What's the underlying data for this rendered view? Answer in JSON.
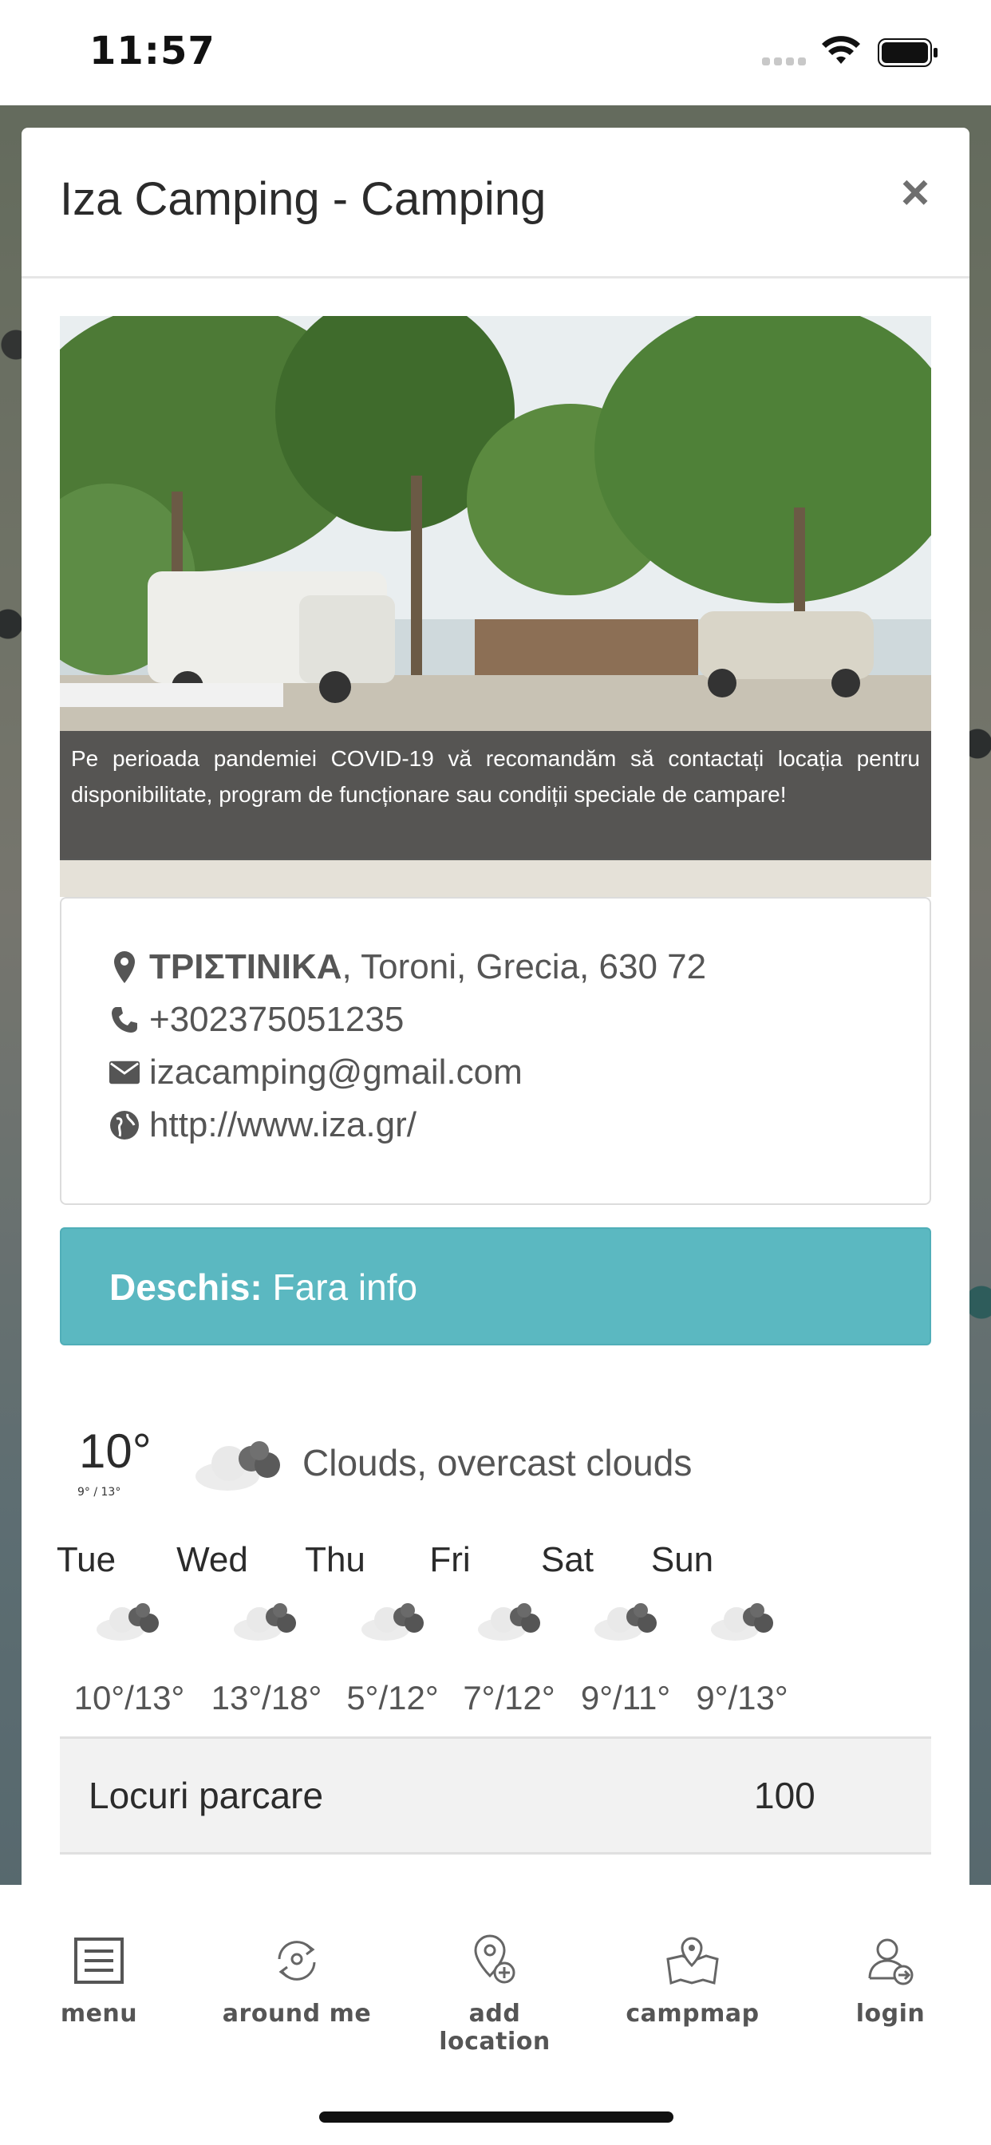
{
  "status_bar": {
    "time": "11:57"
  },
  "modal": {
    "title": "Iza Camping - Camping",
    "close_label": "×",
    "covid_notice": "Pe perioada pandemiei COVID-19 vă recomandăm să contactați locația pentru disponibilitate, program de funcționare sau condiții speciale de campare!"
  },
  "contact": {
    "address_bold": "ΤΡΙΣΤΙΝΙΚΑ",
    "address_rest": ", Toroni, Grecia, 630 72",
    "phone": "+302375051235",
    "email": "izacamping@gmail.com",
    "website": "http://www.iza.gr/"
  },
  "open_status": {
    "label": "Deschis:",
    "value": "Fara info"
  },
  "weather": {
    "current_temp": "10°",
    "current_range": "9° / 13°",
    "description": "Clouds, overcast clouds",
    "forecast": [
      {
        "day": "Tue",
        "temp": "10°/13°"
      },
      {
        "day": "Wed",
        "temp": "13°/18°"
      },
      {
        "day": "Thu",
        "temp": "5°/12°"
      },
      {
        "day": "Fri",
        "temp": "7°/12°"
      },
      {
        "day": "Sat",
        "temp": "9°/11°"
      },
      {
        "day": "Sun",
        "temp": "9°/13°"
      }
    ]
  },
  "details": {
    "label": "Locuri parcare",
    "value": "100"
  },
  "tabbar": {
    "items": [
      {
        "label": "menu",
        "icon": "menu-icon"
      },
      {
        "label": "around me",
        "icon": "around-me-icon"
      },
      {
        "label": "add location",
        "icon": "add-location-icon"
      },
      {
        "label": "campmap",
        "icon": "campmap-icon"
      },
      {
        "label": "login",
        "icon": "login-icon"
      }
    ]
  },
  "colors": {
    "accent": "#5bb8c1",
    "overlay": "#464646"
  }
}
